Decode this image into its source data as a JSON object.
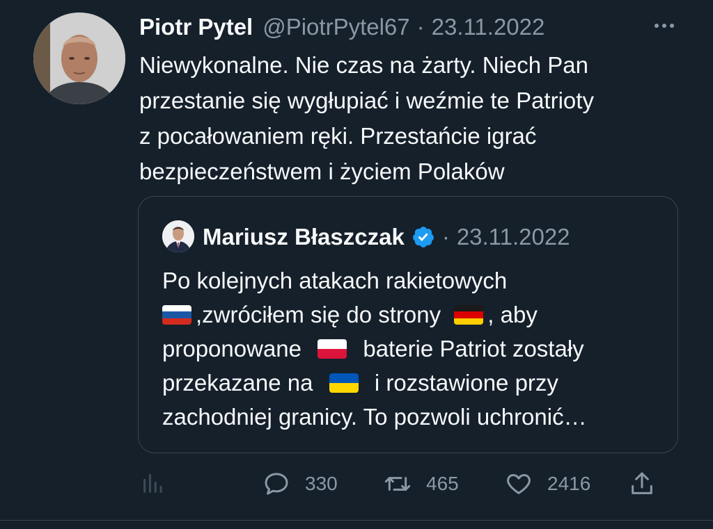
{
  "tweet": {
    "author_name": "Piotr Pytel",
    "author_handle": "@PiotrPytel67",
    "separator": "·",
    "date": "23.11.2022",
    "text_lines": [
      "Niewykonalne. Nie czas na żarty. Niech Pan",
      "przestanie się wygłupiać i weźmie te Patrioty",
      "z pocałowaniem ręki. Przestańcie igrać",
      "bezpieczeństwem i życiem Polaków"
    ]
  },
  "quoted_tweet": {
    "author_name": "Mariusz Błaszczak",
    "verified": true,
    "separator": "·",
    "date": "23.11.2022",
    "line1": "Po kolejnych atakach rakietowych",
    "line2_after_flag": ",zwróciłem się do strony",
    "line2_end": ", aby",
    "line3_start": "proponowane",
    "line3_end": "baterie Patriot zostały",
    "line4_start": "przekazane na",
    "line4_end": "i rozstawione przy",
    "line5": "zachodniej granicy. To pozwoli uchronić…",
    "flags": [
      "russia-flag",
      "germany-flag",
      "poland-flag",
      "ukraine-flag"
    ]
  },
  "actions": {
    "replies": "330",
    "retweets": "465",
    "likes": "2416"
  },
  "colors": {
    "background": "#15202b",
    "text": "#f7f9f9",
    "secondary": "#8b98a5",
    "border": "#38444d",
    "verified": "#1d9bf0"
  }
}
